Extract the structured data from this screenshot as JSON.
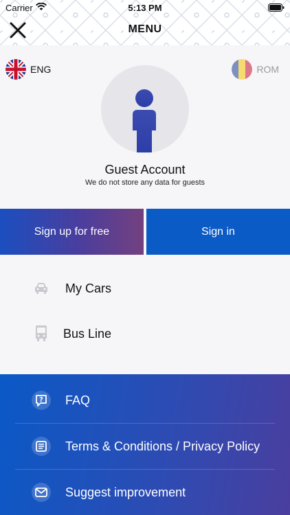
{
  "status_bar": {
    "carrier": "Carrier",
    "time": "5:13 PM"
  },
  "header": {
    "title": "MENU"
  },
  "language": {
    "eng_label": "ENG",
    "rom_label": "ROM"
  },
  "profile": {
    "title": "Guest Account",
    "subtitle": "We do not store any data for guests"
  },
  "actions": {
    "signup_label": "Sign up for free",
    "signin_label": "Sign in"
  },
  "menu_items": [
    {
      "label": "My Cars",
      "icon": "car-icon"
    },
    {
      "label": "Bus Line",
      "icon": "bus-icon"
    }
  ],
  "info_items": [
    {
      "label": "FAQ",
      "icon": "faq-icon"
    },
    {
      "label": "Terms & Conditions / Privacy Policy",
      "icon": "document-icon"
    },
    {
      "label": "Suggest improvement",
      "icon": "mail-icon"
    }
  ],
  "colors": {
    "primary_blue": "#0b5bc6",
    "purple": "#74407f",
    "light_bg": "#f6f6f8"
  }
}
